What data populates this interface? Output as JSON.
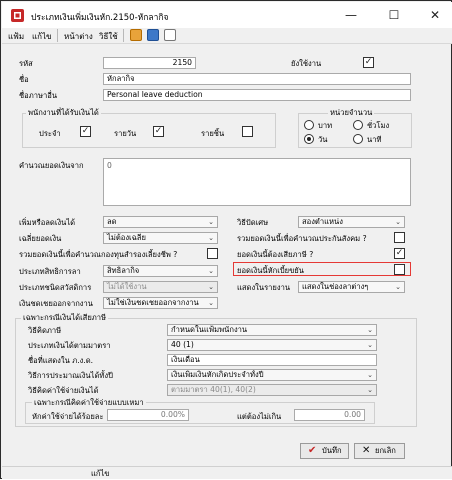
{
  "window": {
    "title": "ประเภทเงินเพิ่มเงินหัก.2150-หักลากิจ",
    "minimize_glyph": "—",
    "maximize_glyph": "☐",
    "close_glyph": "✕"
  },
  "menu": {
    "file": "แฟ้ม",
    "edit": "แก้ไข",
    "window": "หน้าต่าง",
    "help": "วิธีใช้"
  },
  "toolbar_icons": [
    "record-icon",
    "photo-icon",
    "print-icon"
  ],
  "form": {
    "code_label": "รหัส",
    "code_value": "2150",
    "active_label": "ยังใช้งาน",
    "active_checked": true,
    "name_label": "ชื่อ",
    "name_value": "หักลากิจ",
    "name_eng_label": "ชื่อภาษาอื่น",
    "name_eng_value": "Personal leave deduction",
    "employee_group": {
      "title": "พนักงานที่ได้รับเงินได้",
      "monthly_label": "ประจำ",
      "monthly_checked": true,
      "daily_label": "รายวัน",
      "daily_checked": true,
      "piece_label": "รายชิ้น",
      "piece_checked": false
    },
    "unit_group": {
      "title": "หน่วยจำนวน",
      "baht_label": "บาท",
      "hour_label": "ชั่วโมง",
      "day_label": "วัน",
      "minute_label": "นาที",
      "selected": "วัน"
    },
    "calc_label": "คำนวณยอดเงินจาก",
    "calc_value": "0",
    "type_label": "เพิ่มหรือลดเงินได้",
    "type_value": "ลด",
    "avg_label": "เฉลี่ยยอดเงิน",
    "avg_value": "ไม่ต้องเฉลี่ย",
    "pf_label": "รวมยอดเงินนี้เพื่อคำนวณกองทุนสำรองเลี้ยงชีพ ?",
    "pf_checked": false,
    "welfare_label": "ประเภทสิทธิการลา",
    "welfare_value": "สิทธิลากิจ",
    "benefit_label": "ประเภทชนิดสวัสดิการ",
    "benefit_value": "ไม่ได้ใช้งาน",
    "overtime_label": "เงินชดเชยออกจากงาน",
    "overtime_value": "ไม่ใช่เงินชดเชยออกจากงาน",
    "print_method_label": "วิธีปัดเศษ",
    "print_method_value": "สองตำแหน่ง",
    "sso_label": "รวมยอดเงินนี้เพื่อคำนวณประกันสังคม ?",
    "sso_checked": false,
    "taxable_label": "ยอดเงินนี้ต้องเสียภาษี ?",
    "taxable_checked": true,
    "diligence_label": "ยอดเงินนี้หักเบี้ยขยัน",
    "diligence_checked": false,
    "report_label": "แสดงในรายงาน",
    "report_value": "แสดงในช่องลาต่างๆ"
  },
  "tax": {
    "title": "เฉพาะกรณีเงินได้เสียภาษี",
    "tax_method_label": "วิธีคิดภาษี",
    "tax_method_value": "กำหนดในแฟ้มพนักงาน",
    "income_type_label": "ประเภทเงินได้ตามมาตรา",
    "income_type_value": "40 (1)",
    "pnd_name_label": "ชื่อที่แสดงใน ภ.ง.ด.",
    "pnd_name_value": "เงินเดือน",
    "estimate_label": "วิธีการประมาณเงินได้ทั้งปี",
    "estimate_value": "เงินเพิ่มเงินหักเกิดประจำทั้งปี",
    "expense_label": "วิธีคิดค่าใช้จ่ายเงินได้",
    "expense_value": "ตามมาตรา 40(1), 40(2)",
    "sub": {
      "title": "เฉพาะกรณีคิดค่าใช้จ่ายแบบเหมา",
      "percent_label": "หักค่าใช้จ่ายได้ร้อยละ",
      "percent_value": "0.00%",
      "max_label": "แต่ต้องไม่เกิน",
      "max_value": "0.00"
    }
  },
  "buttons": {
    "save": "บันทึก",
    "cancel": "ยกเลิก"
  },
  "status": {
    "text": "แก้ไข"
  }
}
